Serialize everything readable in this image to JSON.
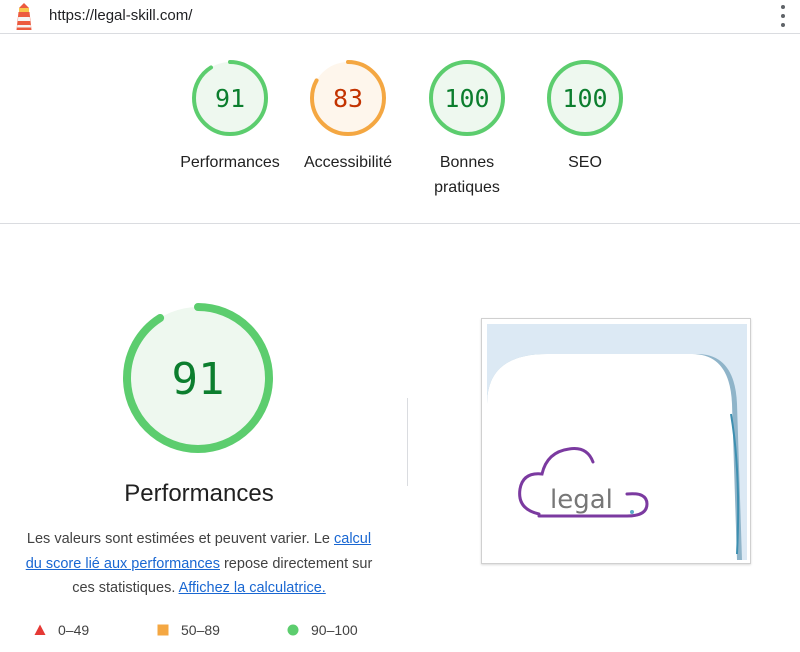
{
  "topbar": {
    "url": "https://legal-skill.com/",
    "logo_icon": "lighthouse-icon",
    "menu_icon": "more-vertical-icon"
  },
  "colors": {
    "pass": "#0c7e2e",
    "pass_ring": "#5ccd6e",
    "pass_fill": "#eef8ef",
    "average": "#c33300",
    "average_ring": "#f4a742",
    "average_fill": "#fef6ec",
    "fail": "#e53935",
    "link": "#1967d2"
  },
  "summary": {
    "gauges": [
      {
        "score": 91,
        "label": "Performances",
        "rating": "pass"
      },
      {
        "score": 83,
        "label": "Accessibilité",
        "rating": "average"
      },
      {
        "score": 100,
        "label": "Bonnes pratiques",
        "label_line1": "Bonnes",
        "label_line2": "pratiques",
        "rating": "pass"
      },
      {
        "score": 100,
        "label": "SEO",
        "rating": "pass"
      }
    ]
  },
  "performance": {
    "score": 91,
    "title": "Performances",
    "desc_part1": "Les valeurs sont estimées et peuvent varier. Le ",
    "desc_link1": "calcul du score lié aux performances",
    "desc_part2": " repose directement sur ces statistiques. ",
    "desc_link2": "Affichez la calculatrice."
  },
  "legend": {
    "fail": "0–49",
    "average": "50–89",
    "pass": "90–100"
  },
  "screenshot": {
    "logo_text": "legal"
  }
}
